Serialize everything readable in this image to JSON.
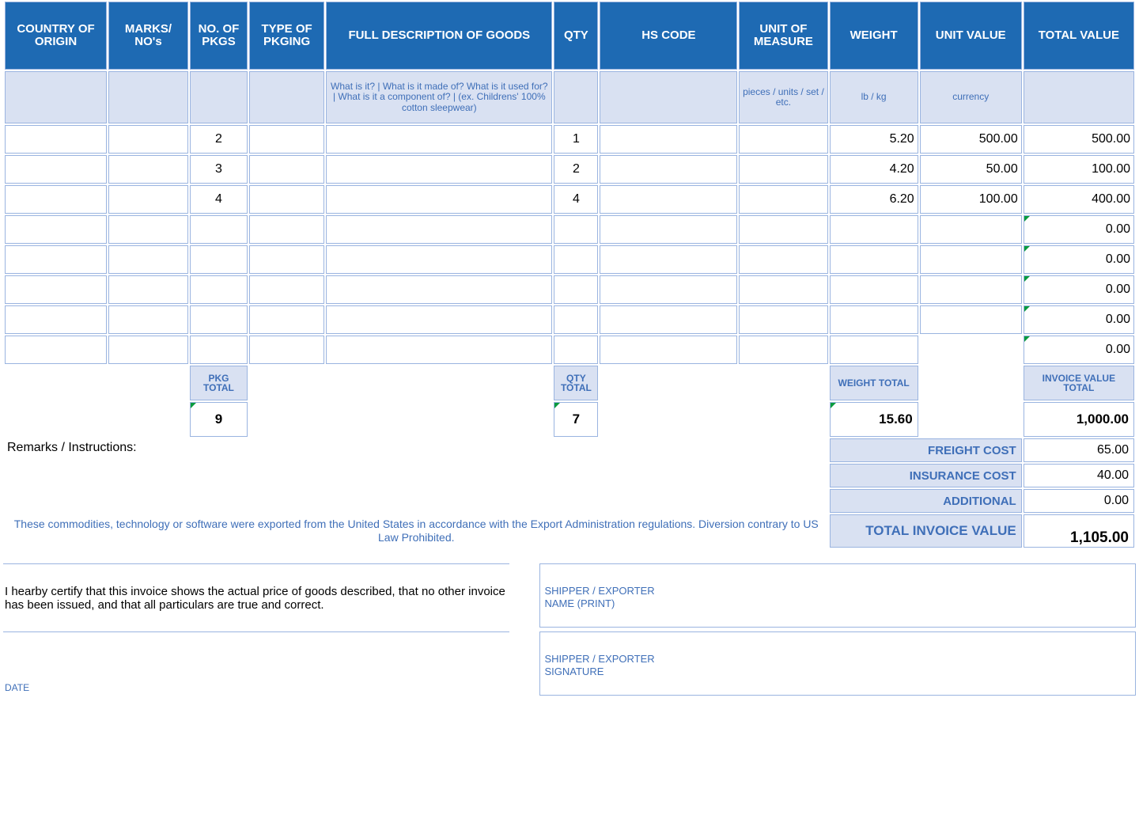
{
  "headers": {
    "country": "COUNTRY OF ORIGIN",
    "marks": "MARKS/ NO's",
    "pkgs": "NO. OF PKGS",
    "pkging": "TYPE OF PKGING",
    "desc": "FULL DESCRIPTION OF GOODS",
    "qty": "QTY",
    "hs": "HS CODE",
    "uom": "UNIT OF MEASURE",
    "weight": "WEIGHT",
    "unitvalue": "UNIT VALUE",
    "totalvalue": "TOTAL VALUE"
  },
  "hints": {
    "desc": "What is it? | What is it made of? What is it used for? | What is it a component of? | (ex. Childrens' 100% cotton sleepwear)",
    "uom": "pieces / units / set / etc.",
    "weight": "lb / kg",
    "unitvalue": "currency"
  },
  "rows": [
    {
      "pkgs": "2",
      "qty": "1",
      "weight": "5.20",
      "unitvalue": "500.00",
      "totalvalue": "500.00"
    },
    {
      "pkgs": "3",
      "qty": "2",
      "weight": "4.20",
      "unitvalue": "50.00",
      "totalvalue": "100.00"
    },
    {
      "pkgs": "4",
      "qty": "4",
      "weight": "6.20",
      "unitvalue": "100.00",
      "totalvalue": "400.00"
    },
    {
      "totalvalue": "0.00"
    },
    {
      "totalvalue": "0.00"
    },
    {
      "totalvalue": "0.00"
    },
    {
      "totalvalue": "0.00"
    },
    {
      "totalvalue": "0.00"
    }
  ],
  "subheaders": {
    "pkg": "PKG TOTAL",
    "qty": "QTY TOTAL",
    "weight": "WEIGHT TOTAL",
    "invoice": "INVOICE VALUE TOTAL"
  },
  "subtotals": {
    "pkg": "9",
    "qty": "7",
    "weight": "15.60",
    "invoice": "1,000.00"
  },
  "remarks_label": "Remarks / Instructions:",
  "costs": {
    "freight_label": "FREIGHT COST",
    "freight_value": "65.00",
    "insurance_label": "INSURANCE COST",
    "insurance_value": "40.00",
    "additional_label": "ADDITIONAL",
    "additional_value": "0.00",
    "total_label": "TOTAL INVOICE VALUE",
    "total_value": "1,105.00"
  },
  "disclaimer": "These commodities, technology or software were exported from the United States in accordance with the Export Administration regulations.  Diversion contrary to US Law Prohibited.",
  "certify": "I hearby certify that this invoice shows the actual price of goods described, that no other invoice has been issued, and that all particulars are true and correct.",
  "date_label": "DATE",
  "sig1_l1": "SHIPPER / EXPORTER",
  "sig1_l2": "NAME (PRINT)",
  "sig2_l1": "SHIPPER / EXPORTER",
  "sig2_l2": "SIGNATURE"
}
